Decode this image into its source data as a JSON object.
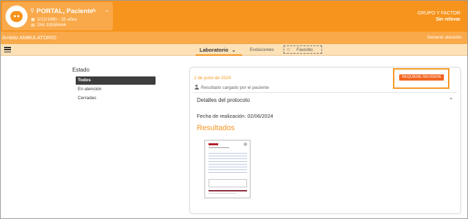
{
  "patient": {
    "name": "PORTAL, Paciente",
    "birth": "2/12/1990 - 33 años",
    "dni": "DNI  33555444"
  },
  "org": {
    "name": "GRUPO Y FACTOR",
    "status": "Sin relevar"
  },
  "ambito": {
    "label": "Ámbito AMBULATORIO",
    "action": "Generar atención"
  },
  "tabs": {
    "laboratorio": "Laboratorio",
    "evoluciones": "Evoluciones",
    "favorito": "Favorito"
  },
  "filters": {
    "title": "Estado",
    "items": [
      "Todos",
      "En atención",
      "Cerradas"
    ],
    "selected": "Todos"
  },
  "card": {
    "date": "2 de junio de 2024",
    "uploaded_by": "Resultado cargado por el paciente",
    "badge": "REQUIERE REVISION",
    "details_title": "Detalles del protocolo",
    "fecha_realizacion": "Fecha de realización: 02/06/2024",
    "resultados_title": "Resultados"
  },
  "colors": {
    "primary": "#f7941d",
    "primary_light": "#f9a94a",
    "tab_bar": "#fde2b8",
    "badge": "#f26522",
    "active_filter": "#3d3d3d"
  },
  "icons": [
    "avatar-icon",
    "pin-icon",
    "pencil-icon",
    "chevron-down-icon",
    "calendar-icon",
    "id-card-icon",
    "menu-icon",
    "star-icon",
    "user-icon",
    "chevron-up-icon"
  ]
}
